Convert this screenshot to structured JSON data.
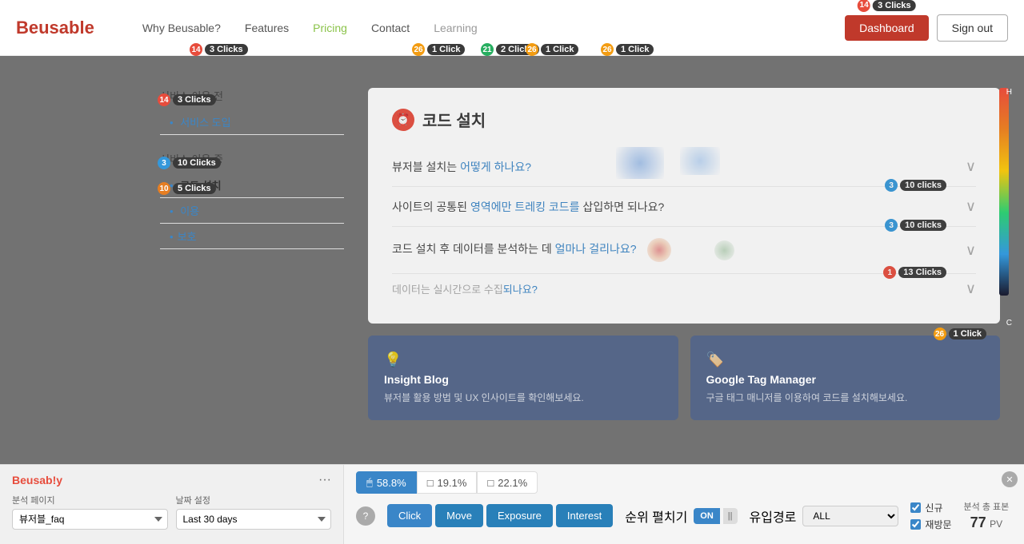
{
  "brand": "Beusable",
  "nav": {
    "links": [
      {
        "id": "why",
        "label": "Why Beusable?"
      },
      {
        "id": "features",
        "label": "Features"
      },
      {
        "id": "pricing",
        "label": "Pricing"
      },
      {
        "id": "contact",
        "label": "Contact"
      },
      {
        "id": "learning",
        "label": "Learning"
      }
    ],
    "dashboard_label": "Dashboard",
    "signout_label": "Sign out"
  },
  "badges": {
    "nav_logo": {
      "num": "14",
      "text": "3 Clicks",
      "num_class": "n14"
    },
    "features": {
      "num": "21",
      "text": "1 Click",
      "num_class": "n21"
    },
    "features2": {
      "num": "21",
      "text": "2 Clicks",
      "num_class": "n21"
    },
    "features3": {
      "num": "26",
      "text": "1 Click",
      "num_class": "n26"
    },
    "contact": {
      "num": "26",
      "text": "1 Click",
      "num_class": "n26"
    },
    "dashboard": {
      "num": "14",
      "text": "3 Clicks",
      "num_class": "n14"
    },
    "sidebar1": {
      "num": "14",
      "text": "3 Clicks",
      "num_class": "n14"
    },
    "sidebar2": {
      "num": "3",
      "text": "10 Clicks",
      "num_class": "n3"
    },
    "sidebar3": {
      "num": "10",
      "text": "5 Clicks",
      "num_class": "n10"
    },
    "faq1": {
      "num": "3",
      "text": "10 clicks",
      "num_class": "n3"
    },
    "faq2": {
      "num": "3",
      "text": "10 clicks",
      "num_class": "n3"
    },
    "faq3": {
      "num": "1",
      "text": "13 Clicks",
      "num_class": "n1"
    },
    "bottom_card": {
      "num": "26",
      "text": "1 Click",
      "num_class": "n26"
    }
  },
  "sidebar": {
    "section1_title": "서비스 이용 전",
    "item1": "서비스 도입",
    "section2_title": "서비스 이용 중",
    "item2": "코드 설치",
    "item3": "이용"
  },
  "content": {
    "card_title": "코드 설치",
    "faq_items": [
      {
        "text1": "뷰저블 설치는 ",
        "highlight": "어떻게 하나요?",
        "text2": ""
      },
      {
        "text1": "사이트의 공통된 ",
        "highlight": "영역에만 트레킹 코드를",
        "text2": " 삽입하면 되나요?"
      },
      {
        "text1": "코드 설치 후 데이터를 분석하는 데 ",
        "highlight": "얼마나 걸리나요?",
        "text2": ""
      }
    ],
    "bottom_cards": [
      {
        "icon": "💡",
        "title": "Insight Blog",
        "desc": "뷰저블 활용 방법 및 UX 인사이트를 확인해보세요."
      },
      {
        "icon": "🏷️",
        "title": "Google Tag Manager",
        "desc": "구글 태그 매니저를 이용하여 코드를 설치해보세요."
      }
    ]
  },
  "toolbar": {
    "brand": "Beusab!y",
    "dots": "···",
    "field1_label": "분석 페이지",
    "field1_value": "뷰저블_faq",
    "field2_label": "날짜 설정",
    "field2_value": "Last 30 days",
    "stats": [
      {
        "icon": "□",
        "value": "58.8%",
        "active": true
      },
      {
        "icon": "□",
        "value": "19.1%"
      },
      {
        "icon": "□",
        "value": "22.1%"
      }
    ],
    "actions": [
      {
        "id": "click",
        "label": "Click",
        "active": true
      },
      {
        "id": "move",
        "label": "Move"
      },
      {
        "id": "exposure",
        "label": "Exposure"
      },
      {
        "id": "interest",
        "label": "Interest"
      }
    ],
    "ranking_label": "순위 펼치기",
    "toggle_on": "ON",
    "toggle_pause": "||",
    "path_label": "유입경로",
    "path_value": "ALL",
    "checkbox1_label": "신규",
    "checkbox2_label": "재방문",
    "pv_label": "분석 총 표본",
    "pv_value": "77",
    "pv_unit": "PV"
  },
  "colorscale": {
    "h_label": "H",
    "c_label": "C"
  }
}
